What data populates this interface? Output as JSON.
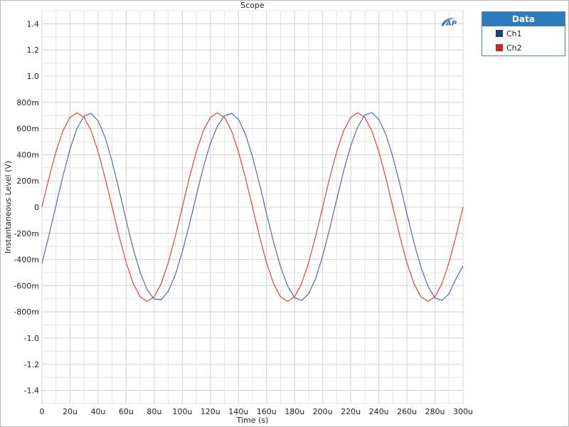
{
  "chart_data": {
    "type": "line",
    "title": "Scope",
    "xlabel": "Time (s)",
    "ylabel": "Instantaneous Level (V)",
    "xlim": [
      0,
      0.0003
    ],
    "ylim": [
      -1.5,
      1.5
    ],
    "grid": true,
    "legend_position": "top-right",
    "xticks": [
      {
        "value": 0,
        "label": "0"
      },
      {
        "value": 2e-05,
        "label": "20u"
      },
      {
        "value": 4e-05,
        "label": "40u"
      },
      {
        "value": 6e-05,
        "label": "60u"
      },
      {
        "value": 8e-05,
        "label": "80u"
      },
      {
        "value": 0.0001,
        "label": "100u"
      },
      {
        "value": 0.00012,
        "label": "120u"
      },
      {
        "value": 0.00014,
        "label": "140u"
      },
      {
        "value": 0.00016,
        "label": "160u"
      },
      {
        "value": 0.00018,
        "label": "180u"
      },
      {
        "value": 0.0002,
        "label": "200u"
      },
      {
        "value": 0.00022,
        "label": "220u"
      },
      {
        "value": 0.00024,
        "label": "240u"
      },
      {
        "value": 0.00026,
        "label": "260u"
      },
      {
        "value": 0.00028,
        "label": "280u"
      },
      {
        "value": 0.0003,
        "label": "300u"
      }
    ],
    "yticks": [
      {
        "value": 1.4,
        "label": "1.4"
      },
      {
        "value": 1.2,
        "label": "1.2"
      },
      {
        "value": 1.0,
        "label": "1.0"
      },
      {
        "value": 0.8,
        "label": "800m"
      },
      {
        "value": 0.6,
        "label": "600m"
      },
      {
        "value": 0.4,
        "label": "400m"
      },
      {
        "value": 0.2,
        "label": "200m"
      },
      {
        "value": 0,
        "label": "0"
      },
      {
        "value": -0.2,
        "label": "-200m"
      },
      {
        "value": -0.4,
        "label": "-400m"
      },
      {
        "value": -0.6,
        "label": "-600m"
      },
      {
        "value": -0.8,
        "label": "-800m"
      },
      {
        "value": -1.0,
        "label": "-1.0"
      },
      {
        "value": -1.2,
        "label": "-1.2"
      },
      {
        "value": -1.4,
        "label": "-1.4"
      }
    ],
    "legend_title": "Data",
    "series": [
      {
        "name": "Ch1",
        "color": "#4a6ea6",
        "swatch_color": "#1f3d7a",
        "x": [
          0,
          5e-06,
          1e-05,
          1.5e-05,
          2e-05,
          2.5e-05,
          3e-05,
          3.5e-05,
          4e-05,
          4.5e-05,
          5e-05,
          5.5e-05,
          6e-05,
          6.5e-05,
          7e-05,
          7.5e-05,
          8e-05,
          8.5e-05,
          9e-05,
          9.5e-05,
          0.0001,
          0.000105,
          0.00011,
          0.000115,
          0.00012,
          0.000125,
          0.00013,
          0.000135,
          0.00014,
          0.000145,
          0.00015,
          0.000155,
          0.00016,
          0.000165,
          0.00017,
          0.000175,
          0.00018,
          0.000185,
          0.00019,
          0.000195,
          0.0002,
          0.000205,
          0.00021,
          0.000215,
          0.00022,
          0.000225,
          0.00023,
          0.000235,
          0.00024,
          0.000245,
          0.00025,
          0.000255,
          0.00026,
          0.000265,
          0.00027,
          0.000275,
          0.00028,
          0.000285,
          0.00029,
          0.000295,
          0.0003
        ],
        "values": [
          -0.429,
          -0.214,
          0.013,
          0.239,
          0.443,
          0.602,
          0.695,
          0.715,
          0.659,
          0.532,
          0.348,
          0.128,
          -0.102,
          -0.318,
          -0.5,
          -0.632,
          -0.703,
          -0.707,
          -0.643,
          -0.517,
          -0.341,
          -0.133,
          0.09,
          0.305,
          0.487,
          0.618,
          0.697,
          0.716,
          0.671,
          0.556,
          0.384,
          0.176,
          -0.049,
          -0.268,
          -0.456,
          -0.603,
          -0.692,
          -0.713,
          -0.662,
          -0.546,
          -0.374,
          -0.166,
          0.059,
          0.278,
          0.467,
          0.613,
          0.703,
          0.722,
          0.671,
          0.555,
          0.384,
          0.175,
          -0.05,
          -0.269,
          -0.458,
          -0.604,
          -0.693,
          -0.714,
          -0.662,
          -0.546,
          -0.45
        ]
      },
      {
        "name": "Ch2",
        "color": "#d2493f",
        "swatch_color": "#c0282a",
        "x": [
          0,
          5e-06,
          1e-05,
          1.5e-05,
          2e-05,
          2.5e-05,
          3e-05,
          3.5e-05,
          4e-05,
          4.5e-05,
          5e-05,
          5.5e-05,
          6e-05,
          6.5e-05,
          7e-05,
          7.5e-05,
          8e-05,
          8.5e-05,
          9e-05,
          9.5e-05,
          0.0001,
          0.000105,
          0.00011,
          0.000115,
          0.00012,
          0.000125,
          0.00013,
          0.000135,
          0.00014,
          0.000145,
          0.00015,
          0.000155,
          0.00016,
          0.000165,
          0.00017,
          0.000175,
          0.00018,
          0.000185,
          0.00019,
          0.000195,
          0.0002,
          0.000205,
          0.00021,
          0.000215,
          0.00022,
          0.000225,
          0.00023,
          0.000235,
          0.00024,
          0.000245,
          0.00025,
          0.000255,
          0.00026,
          0.000265,
          0.00027,
          0.000275,
          0.00028,
          0.000285,
          0.00029,
          0.000295,
          0.0003
        ],
        "values": [
          0.0,
          0.223,
          0.424,
          0.584,
          0.685,
          0.72,
          0.685,
          0.584,
          0.424,
          0.223,
          0.0,
          -0.223,
          -0.424,
          -0.584,
          -0.685,
          -0.72,
          -0.685,
          -0.584,
          -0.424,
          -0.223,
          0.0,
          0.223,
          0.424,
          0.584,
          0.685,
          0.72,
          0.685,
          0.584,
          0.424,
          0.223,
          0.0,
          -0.223,
          -0.424,
          -0.584,
          -0.685,
          -0.72,
          -0.685,
          -0.584,
          -0.424,
          -0.223,
          0.0,
          0.223,
          0.424,
          0.584,
          0.685,
          0.72,
          0.685,
          0.584,
          0.424,
          0.223,
          0.0,
          -0.223,
          -0.424,
          -0.584,
          -0.685,
          -0.72,
          -0.685,
          -0.584,
          -0.424,
          -0.223,
          0.0
        ]
      }
    ]
  }
}
